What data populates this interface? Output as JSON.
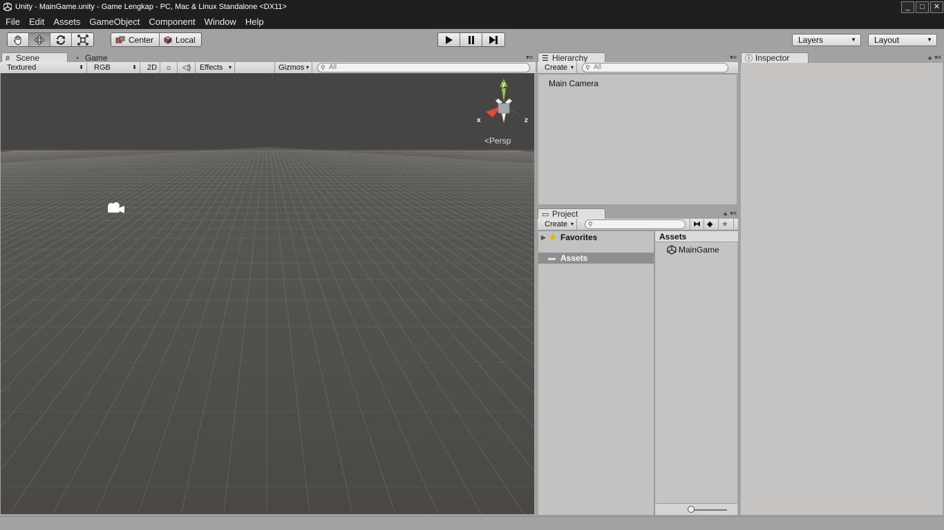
{
  "window": {
    "title": "Unity - MainGame.unity - Game Lengkap - PC, Mac & Linux Standalone <DX11>",
    "controls": {
      "minimize": "_",
      "maximize": "□",
      "close": "✕"
    }
  },
  "menubar": {
    "items": [
      {
        "label": "File"
      },
      {
        "label": "Edit"
      },
      {
        "label": "Assets"
      },
      {
        "label": "GameObject"
      },
      {
        "label": "Component"
      },
      {
        "label": "Window"
      },
      {
        "label": "Help"
      }
    ]
  },
  "toolbar": {
    "tools": [
      "hand-tool",
      "move-tool",
      "rotate-tool",
      "scale-tool"
    ],
    "active_tool": "move-tool",
    "pivot_mode": "Center",
    "pivot_space": "Local",
    "layers_label": "Layers",
    "layout_label": "Layout"
  },
  "scene_panel": {
    "tabs": [
      {
        "label": "Scene",
        "icon": "grid-icon",
        "active": true
      },
      {
        "label": "Game",
        "icon": "pacman-icon",
        "active": false
      }
    ],
    "render_mode": "Textured",
    "color_mode": "RGB",
    "mode_2d": "2D",
    "effects_label": "Effects",
    "gizmos_label": "Gizmos",
    "search_placeholder": "All",
    "projection_label": "Persp",
    "axis_labels": {
      "x": "x",
      "y": "y",
      "z": "z"
    },
    "colors": {
      "x_axis": "#d23a2c",
      "y_axis": "#7fc236",
      "z_axis": "#3a6ed2",
      "sky": "#474543",
      "grid_line": "#a9a6a2"
    }
  },
  "hierarchy_panel": {
    "tab_label": "Hierarchy",
    "create_label": "Create",
    "search_placeholder": "All",
    "items": [
      {
        "label": "Main Camera"
      }
    ]
  },
  "project_panel": {
    "tab_label": "Project",
    "create_label": "Create",
    "tree": [
      {
        "label": "Favorites",
        "icon": "star-icon",
        "selected": false
      },
      {
        "label": "Assets",
        "icon": "folder-icon",
        "selected": true
      }
    ],
    "assets_header": "Assets",
    "assets": [
      {
        "label": "MainGame",
        "icon": "unity-scene-icon"
      }
    ]
  },
  "inspector_panel": {
    "tab_label": "Inspector"
  }
}
